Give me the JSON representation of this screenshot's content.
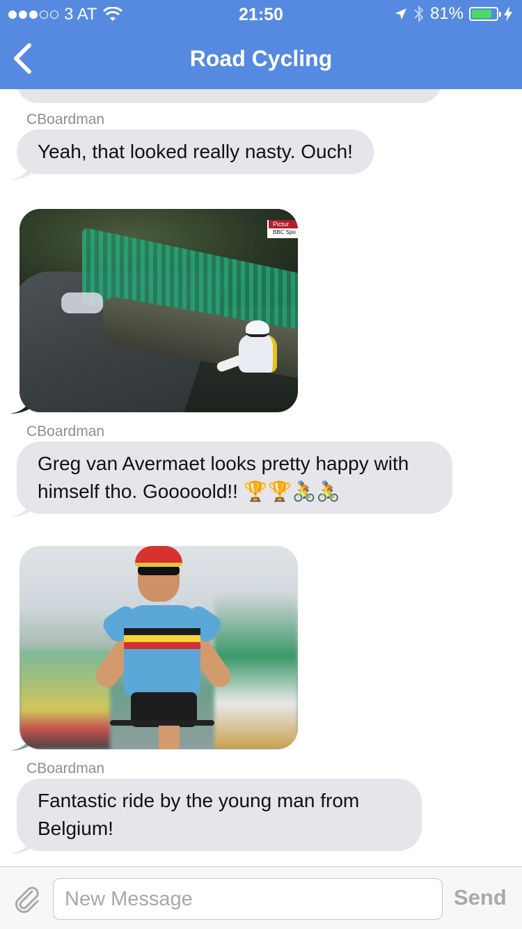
{
  "status_bar": {
    "carrier": "3 AT",
    "time": "21:50",
    "battery": "81%",
    "battery_level": 0.81,
    "signal_bars": 3,
    "signal_total": 5
  },
  "nav": {
    "title": "Road Cycling"
  },
  "messages": [
    {
      "sender": "CBoardman",
      "text": "Yeah, that looked really nasty. Ouch!"
    },
    {
      "sender": "CBoardman",
      "text": "Greg van Avermaet looks pretty happy with himself tho. Gooooold!! 🏆🏆🚴🚴"
    },
    {
      "sender": "CBoardman",
      "text": "Fantastic ride by the young man from Belgium!"
    }
  ],
  "images": {
    "crash_overlay_top": "Pictur",
    "crash_overlay_bottom": "BBC Spo"
  },
  "composer": {
    "placeholder": "New Message",
    "send_label": "Send"
  },
  "colors": {
    "header": "#568ae0",
    "bubble": "#e5e5ea",
    "battery_fill": "#4cd964"
  }
}
